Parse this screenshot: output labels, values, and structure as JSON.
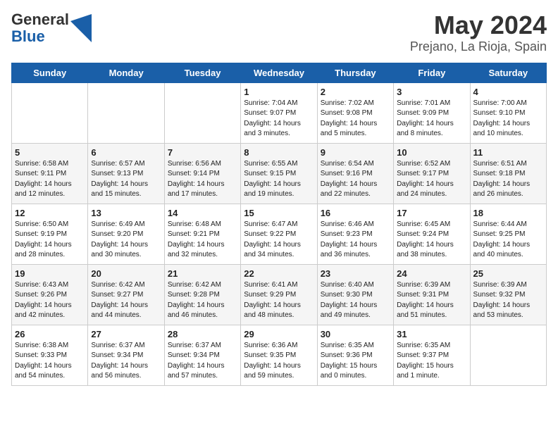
{
  "header": {
    "logo_general": "General",
    "logo_blue": "Blue",
    "title": "May 2024",
    "subtitle": "Prejano, La Rioja, Spain"
  },
  "days_of_week": [
    "Sunday",
    "Monday",
    "Tuesday",
    "Wednesday",
    "Thursday",
    "Friday",
    "Saturday"
  ],
  "weeks": [
    [
      {
        "day": "",
        "sunrise": "",
        "sunset": "",
        "daylight": ""
      },
      {
        "day": "",
        "sunrise": "",
        "sunset": "",
        "daylight": ""
      },
      {
        "day": "",
        "sunrise": "",
        "sunset": "",
        "daylight": ""
      },
      {
        "day": "1",
        "sunrise": "Sunrise: 7:04 AM",
        "sunset": "Sunset: 9:07 PM",
        "daylight": "Daylight: 14 hours and 3 minutes."
      },
      {
        "day": "2",
        "sunrise": "Sunrise: 7:02 AM",
        "sunset": "Sunset: 9:08 PM",
        "daylight": "Daylight: 14 hours and 5 minutes."
      },
      {
        "day": "3",
        "sunrise": "Sunrise: 7:01 AM",
        "sunset": "Sunset: 9:09 PM",
        "daylight": "Daylight: 14 hours and 8 minutes."
      },
      {
        "day": "4",
        "sunrise": "Sunrise: 7:00 AM",
        "sunset": "Sunset: 9:10 PM",
        "daylight": "Daylight: 14 hours and 10 minutes."
      }
    ],
    [
      {
        "day": "5",
        "sunrise": "Sunrise: 6:58 AM",
        "sunset": "Sunset: 9:11 PM",
        "daylight": "Daylight: 14 hours and 12 minutes."
      },
      {
        "day": "6",
        "sunrise": "Sunrise: 6:57 AM",
        "sunset": "Sunset: 9:13 PM",
        "daylight": "Daylight: 14 hours and 15 minutes."
      },
      {
        "day": "7",
        "sunrise": "Sunrise: 6:56 AM",
        "sunset": "Sunset: 9:14 PM",
        "daylight": "Daylight: 14 hours and 17 minutes."
      },
      {
        "day": "8",
        "sunrise": "Sunrise: 6:55 AM",
        "sunset": "Sunset: 9:15 PM",
        "daylight": "Daylight: 14 hours and 19 minutes."
      },
      {
        "day": "9",
        "sunrise": "Sunrise: 6:54 AM",
        "sunset": "Sunset: 9:16 PM",
        "daylight": "Daylight: 14 hours and 22 minutes."
      },
      {
        "day": "10",
        "sunrise": "Sunrise: 6:52 AM",
        "sunset": "Sunset: 9:17 PM",
        "daylight": "Daylight: 14 hours and 24 minutes."
      },
      {
        "day": "11",
        "sunrise": "Sunrise: 6:51 AM",
        "sunset": "Sunset: 9:18 PM",
        "daylight": "Daylight: 14 hours and 26 minutes."
      }
    ],
    [
      {
        "day": "12",
        "sunrise": "Sunrise: 6:50 AM",
        "sunset": "Sunset: 9:19 PM",
        "daylight": "Daylight: 14 hours and 28 minutes."
      },
      {
        "day": "13",
        "sunrise": "Sunrise: 6:49 AM",
        "sunset": "Sunset: 9:20 PM",
        "daylight": "Daylight: 14 hours and 30 minutes."
      },
      {
        "day": "14",
        "sunrise": "Sunrise: 6:48 AM",
        "sunset": "Sunset: 9:21 PM",
        "daylight": "Daylight: 14 hours and 32 minutes."
      },
      {
        "day": "15",
        "sunrise": "Sunrise: 6:47 AM",
        "sunset": "Sunset: 9:22 PM",
        "daylight": "Daylight: 14 hours and 34 minutes."
      },
      {
        "day": "16",
        "sunrise": "Sunrise: 6:46 AM",
        "sunset": "Sunset: 9:23 PM",
        "daylight": "Daylight: 14 hours and 36 minutes."
      },
      {
        "day": "17",
        "sunrise": "Sunrise: 6:45 AM",
        "sunset": "Sunset: 9:24 PM",
        "daylight": "Daylight: 14 hours and 38 minutes."
      },
      {
        "day": "18",
        "sunrise": "Sunrise: 6:44 AM",
        "sunset": "Sunset: 9:25 PM",
        "daylight": "Daylight: 14 hours and 40 minutes."
      }
    ],
    [
      {
        "day": "19",
        "sunrise": "Sunrise: 6:43 AM",
        "sunset": "Sunset: 9:26 PM",
        "daylight": "Daylight: 14 hours and 42 minutes."
      },
      {
        "day": "20",
        "sunrise": "Sunrise: 6:42 AM",
        "sunset": "Sunset: 9:27 PM",
        "daylight": "Daylight: 14 hours and 44 minutes."
      },
      {
        "day": "21",
        "sunrise": "Sunrise: 6:42 AM",
        "sunset": "Sunset: 9:28 PM",
        "daylight": "Daylight: 14 hours and 46 minutes."
      },
      {
        "day": "22",
        "sunrise": "Sunrise: 6:41 AM",
        "sunset": "Sunset: 9:29 PM",
        "daylight": "Daylight: 14 hours and 48 minutes."
      },
      {
        "day": "23",
        "sunrise": "Sunrise: 6:40 AM",
        "sunset": "Sunset: 9:30 PM",
        "daylight": "Daylight: 14 hours and 49 minutes."
      },
      {
        "day": "24",
        "sunrise": "Sunrise: 6:39 AM",
        "sunset": "Sunset: 9:31 PM",
        "daylight": "Daylight: 14 hours and 51 minutes."
      },
      {
        "day": "25",
        "sunrise": "Sunrise: 6:39 AM",
        "sunset": "Sunset: 9:32 PM",
        "daylight": "Daylight: 14 hours and 53 minutes."
      }
    ],
    [
      {
        "day": "26",
        "sunrise": "Sunrise: 6:38 AM",
        "sunset": "Sunset: 9:33 PM",
        "daylight": "Daylight: 14 hours and 54 minutes."
      },
      {
        "day": "27",
        "sunrise": "Sunrise: 6:37 AM",
        "sunset": "Sunset: 9:34 PM",
        "daylight": "Daylight: 14 hours and 56 minutes."
      },
      {
        "day": "28",
        "sunrise": "Sunrise: 6:37 AM",
        "sunset": "Sunset: 9:34 PM",
        "daylight": "Daylight: 14 hours and 57 minutes."
      },
      {
        "day": "29",
        "sunrise": "Sunrise: 6:36 AM",
        "sunset": "Sunset: 9:35 PM",
        "daylight": "Daylight: 14 hours and 59 minutes."
      },
      {
        "day": "30",
        "sunrise": "Sunrise: 6:35 AM",
        "sunset": "Sunset: 9:36 PM",
        "daylight": "Daylight: 15 hours and 0 minutes."
      },
      {
        "day": "31",
        "sunrise": "Sunrise: 6:35 AM",
        "sunset": "Sunset: 9:37 PM",
        "daylight": "Daylight: 15 hours and 1 minute."
      },
      {
        "day": "",
        "sunrise": "",
        "sunset": "",
        "daylight": ""
      }
    ]
  ]
}
